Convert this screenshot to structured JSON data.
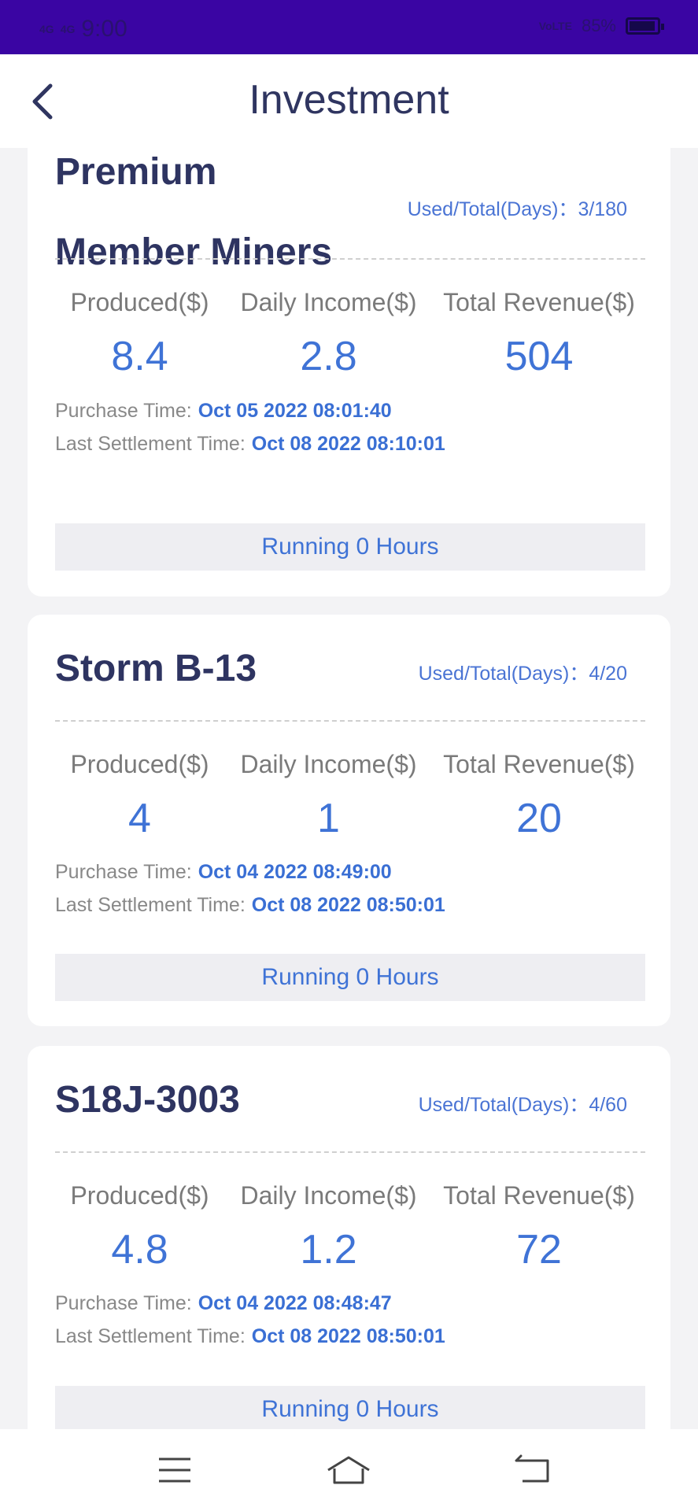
{
  "status_bar": {
    "signal1": "4G",
    "signal2": "4G",
    "time": "9:00",
    "volte": "VoLTE",
    "battery": "85%"
  },
  "header": {
    "title": "Investment"
  },
  "labels": {
    "produced": "Produced($)",
    "daily_income": "Daily Income($)",
    "total_revenue": "Total Revenue($)",
    "purchase_time": "Purchase Time:",
    "last_settlement": "Last Settlement Time:"
  },
  "cards": [
    {
      "name_line1": "Premium",
      "name_line2": "Member Miners",
      "days_label": "Used/Total(Days)：",
      "days_value": "3/180",
      "produced": "8.4",
      "daily_income": "2.8",
      "total_revenue": "504",
      "purchase_time": "Oct 05 2022 08:01:40",
      "last_settlement": "Oct 08 2022 08:10:01",
      "running": "Running 0 Hours"
    },
    {
      "name": "Storm B-13",
      "days_label": "Used/Total(Days)：",
      "days_value": "4/20",
      "produced": "4",
      "daily_income": "1",
      "total_revenue": "20",
      "purchase_time": "Oct 04 2022 08:49:00",
      "last_settlement": "Oct 08 2022 08:50:01",
      "running": "Running 0 Hours"
    },
    {
      "name": "S18J-3003",
      "days_label": "Used/Total(Days)：",
      "days_value": "4/60",
      "produced": "4.8",
      "daily_income": "1.2",
      "total_revenue": "72",
      "purchase_time": "Oct 04 2022 08:48:47",
      "last_settlement": "Oct 08 2022 08:50:01",
      "running": "Running 0 Hours"
    }
  ],
  "nav": {
    "menu": "menu-icon",
    "home": "home-icon",
    "back": "back-icon"
  }
}
